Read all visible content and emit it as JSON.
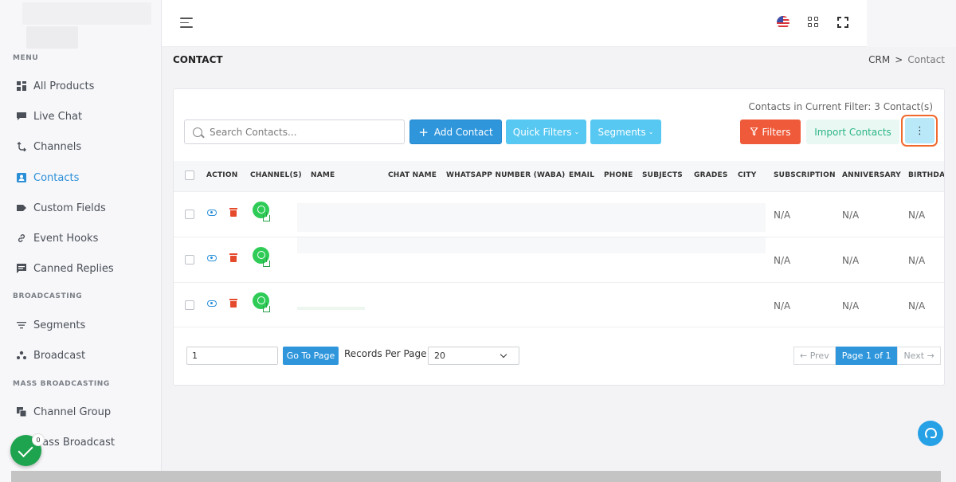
{
  "sidebar": {
    "sections": [
      "MENU",
      "BROADCASTING",
      "MASS BROADCASTING"
    ],
    "items": [
      {
        "label": "All Products",
        "icon": "grid-icon"
      },
      {
        "label": "Live Chat",
        "icon": "chat-icon"
      },
      {
        "label": "Channels",
        "icon": "channels-icon"
      },
      {
        "label": "Contacts",
        "icon": "contacts-icon",
        "active": true
      },
      {
        "label": "Custom Fields",
        "icon": "tag-icon"
      },
      {
        "label": "Event Hooks",
        "icon": "link-icon"
      },
      {
        "label": "Canned Replies",
        "icon": "message-icon"
      },
      {
        "label": "Segments",
        "icon": "filter-icon"
      },
      {
        "label": "Broadcast",
        "icon": "broadcast-icon"
      },
      {
        "label": "Channel Group",
        "icon": "copy-icon"
      },
      {
        "label": "Mass Broadcast",
        "icon": "mass-broadcast-icon"
      }
    ]
  },
  "header": {
    "page_title": "CONTACT",
    "breadcrumb": [
      "CRM",
      "Contact"
    ],
    "breadcrumb_sep": ">"
  },
  "toolbar": {
    "count_text": "Contacts in Current Filter: 3 Contact(s)",
    "search_placeholder": "Search Contacts...",
    "add_contact": "Add Contact",
    "quick_filters": "Quick Filters",
    "segments": "Segments",
    "filters": "Filters",
    "import_contacts": "Import Contacts",
    "more": "⋮"
  },
  "table": {
    "columns": [
      "ACTION",
      "CHANNEL(S)",
      "NAME",
      "CHAT NAME",
      "WHATSAPP NUMBER (WABA)",
      "EMAIL",
      "PHONE",
      "SUBJECTS",
      "GRADES",
      "CITY",
      "SUBSCRIPTION",
      "ANNIVERSARY",
      "BIRTHDAY"
    ],
    "rows": [
      {
        "subscription": "N/A",
        "anniversary": "N/A",
        "birthday": "N/A"
      },
      {
        "subscription": "N/A",
        "anniversary": "N/A",
        "birthday": "N/A"
      },
      {
        "subscription": "N/A",
        "anniversary": "N/A",
        "birthday": "N/A"
      }
    ]
  },
  "pagination": {
    "page_value": "1",
    "go_to_page": "Go To Page",
    "records_per_page": "Records Per Page",
    "per_page_value": "20",
    "prev": "← Prev",
    "current": "Page 1 of 1",
    "next": "Next →"
  },
  "floating": {
    "badge_count": "0"
  },
  "colors": {
    "primary": "#2f96dc",
    "info": "#57c8f2",
    "danger": "#ef5b3a",
    "success": "#2bb487",
    "whatsapp": "#2ecc57"
  }
}
